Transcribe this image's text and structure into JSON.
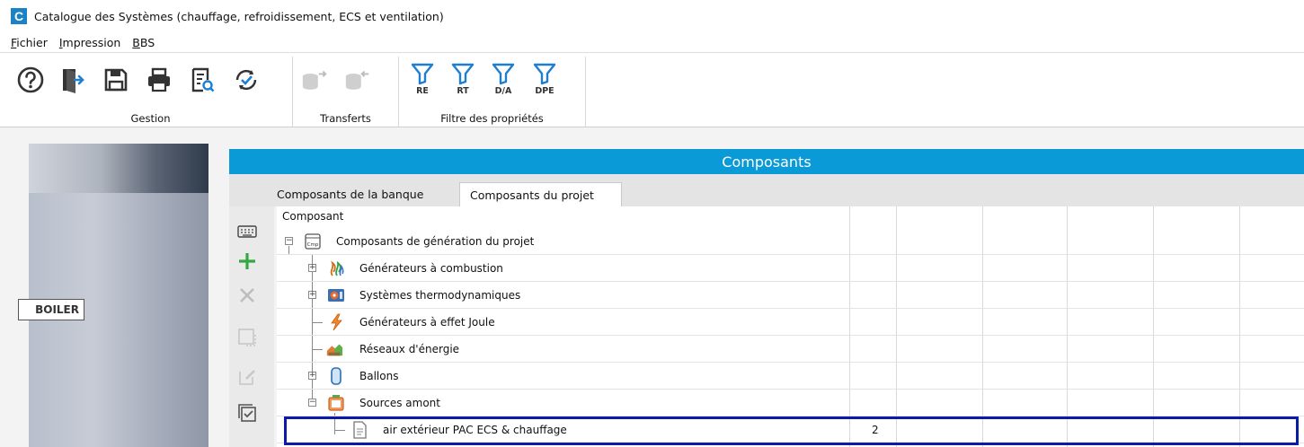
{
  "window": {
    "title": "Catalogue des Systèmes (chauffage, refroidissement, ECS et ventilation)"
  },
  "menubar": {
    "items": [
      "Fichier",
      "Impression",
      "BBS"
    ]
  },
  "ribbon": {
    "groups": {
      "gestion": "Gestion",
      "transferts": "Transferts",
      "filtre": "Filtre des propriétés"
    },
    "filters": [
      "RE",
      "RT",
      "D/A",
      "DPE"
    ],
    "colors": {
      "accent": "#1b82c5",
      "filter": "#1e7fd1",
      "header": "#0a9ad7",
      "selection": "#0b1aa8",
      "add": "#35a845"
    }
  },
  "leftpanel": {
    "badge": "BOILER"
  },
  "components": {
    "title": "Composants",
    "tabs": [
      "Composants de la banque",
      "Composants du projet"
    ],
    "active_tab": "Composants du projet",
    "column_header": "Composant",
    "tree": [
      {
        "label": "Composants de génération du projet",
        "icon": "cmp-icon",
        "expander": "minus"
      },
      {
        "label": "Générateurs à combustion",
        "icon": "flame-icon",
        "expander": "plus"
      },
      {
        "label": "Systèmes thermodynamiques",
        "icon": "heat-pump-icon",
        "expander": "plus"
      },
      {
        "label": "Générateurs à effet Joule",
        "icon": "lightning-icon",
        "expander": "none"
      },
      {
        "label": "Réseaux d'énergie",
        "icon": "network-icon",
        "expander": "none"
      },
      {
        "label": "Ballons",
        "icon": "tank-icon",
        "expander": "plus"
      },
      {
        "label": "Sources amont",
        "icon": "source-icon",
        "expander": "minus"
      },
      {
        "label": "air extérieur PAC ECS & chauffage",
        "icon": "document-icon",
        "expander": "none",
        "value": "2"
      }
    ]
  }
}
